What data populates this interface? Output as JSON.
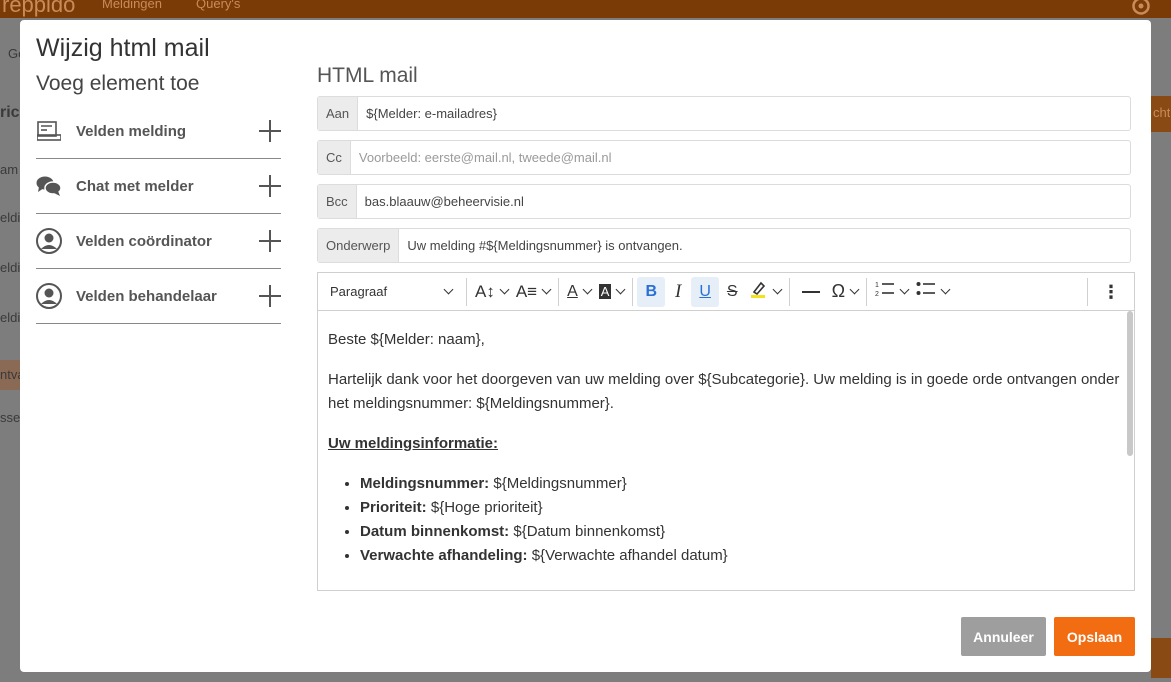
{
  "background": {
    "brand": "reppido",
    "nav": [
      "Meldingen",
      "Query's"
    ],
    "left_fragments": [
      "Ge",
      "ric",
      "am",
      "eldi",
      "eldi",
      "eldi",
      "ntva",
      "sse"
    ],
    "right_fragments": [
      "cht"
    ]
  },
  "modal": {
    "title": "Wijzig html mail"
  },
  "left_panel": {
    "subtitle": "Voeg element toe",
    "items": [
      {
        "label": "Velden melding",
        "icon": "form-icon"
      },
      {
        "label": "Chat met melder",
        "icon": "chat-icon"
      },
      {
        "label": "Velden coördinator",
        "icon": "user-circle-icon"
      },
      {
        "label": "Velden behandelaar",
        "icon": "user-circle-icon"
      }
    ]
  },
  "mail": {
    "section_title": "HTML mail",
    "to_label": "Aan",
    "to_value": "${Melder: e-mailadres}",
    "cc_label": "Cc",
    "cc_placeholder": "Voorbeeld: eerste@mail.nl, tweede@mail.nl",
    "bcc_label": "Bcc",
    "bcc_value": "bas.blaauw@beheervisie.nl",
    "subject_label": "Onderwerp",
    "subject_value": "Uw melding #${Meldingsnummer} is ontvangen."
  },
  "toolbar": {
    "paragraph_label": "Paragraaf"
  },
  "body": {
    "greeting": "Beste ${Melder: naam},",
    "intro": "Hartelijk dank voor het doorgeven van uw melding over ${Subcategorie}. Uw melding is in goede orde ontvangen onder het meldingsnummer: ${Meldingsnummer}.",
    "info_heading": "Uw meldingsinformatie:",
    "info_items": [
      {
        "label": "Meldingsnummer:",
        "value": " ${Meldingsnummer}"
      },
      {
        "label": "Prioriteit:",
        "value": " ${Hoge prioriteit}"
      },
      {
        "label": "Datum binnenkomst:",
        "value": " ${Datum binnenkomst}"
      },
      {
        "label": "Verwachte afhandeling:",
        "value": " ${Verwachte afhandel datum}"
      }
    ]
  },
  "footer": {
    "cancel_label": "Annuleer",
    "save_label": "Opslaan"
  },
  "colors": {
    "accent": "#f26c12",
    "cancel": "#9e9e9e",
    "topbar": "#7a3b06"
  }
}
